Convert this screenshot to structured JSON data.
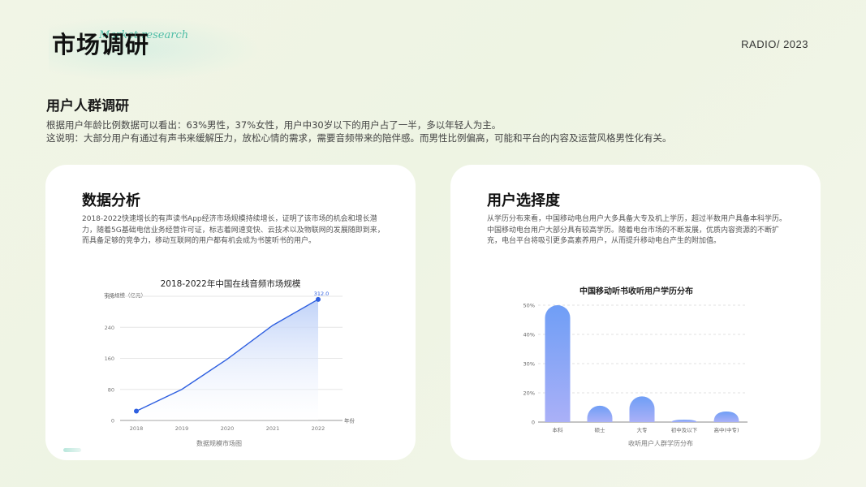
{
  "header": {
    "title": "市场调研",
    "script_text": "Market research",
    "tag": "RADIO/ 2023"
  },
  "section": {
    "title": "用户人群调研",
    "lines": [
      "根据用户年龄比例数据可以看出：63%男性，37%女性，用户中30岁以下的用户占了一半，多以年轻人为主。",
      "这说明：大部分用户有通过有声书来缓解压力，放松心情的需求，需要音频带来的陪伴感。而男性比例偏高，可能和平台的内容及运营风格男性化有关。"
    ]
  },
  "left_card": {
    "title": "数据分析",
    "desc": "2018-2022快速增长的有声读书App经济市场规模持续增长，证明了该市场的机会和增长潜力，随着5G基础电信业务经营许可证，标志着网速变快、云技术以及物联网的发展随即到来，而具备足够的竞争力，移动互联网的用户都有机会成为书箧听书的用户。"
  },
  "right_card": {
    "title": "用户选择度",
    "desc": "从学历分布来看，中国移动电台用户大多具备大专及机上学历，超过半数用户具备本科学历。中国移动电台用户大部分具有较高学历。随着电台市场的不断发展，优质内容资源的不断扩充，电台平台将吸引更多高素养用户，从而提升移动电台产生的附加值。"
  },
  "colors": {
    "line": "#2e5fe0",
    "area_top": "#b9cdf7",
    "bar_top": "#6f9ef6",
    "bar_bottom": "#aab0f7",
    "accent": "#3fb8a0"
  },
  "chart_data": [
    {
      "type": "area",
      "title": "2018-2022年中国在线音频市场规模",
      "ylabel": "市场规模（亿元）",
      "xlabel": "年份",
      "caption": "数据规模市场图",
      "x": [
        "2018",
        "2019",
        "2020",
        "2021",
        "2022"
      ],
      "values": [
        24,
        80,
        158,
        245,
        312
      ],
      "yticks": [
        0,
        80,
        160,
        240,
        320
      ],
      "ylim": [
        0,
        340
      ],
      "data_labels": {
        "2022": "312.0"
      },
      "grid": true
    },
    {
      "type": "bar",
      "title": "中国移动听书收听用户学历分布",
      "caption": "收听用户人群学历分布",
      "categories": [
        "本科",
        "硕士",
        "大专",
        "初中及以下",
        "高中(中专)"
      ],
      "values": [
        50,
        7,
        11,
        1,
        4.5
      ],
      "yticks": [
        "0",
        "20%",
        "30%",
        "40%",
        "50%"
      ],
      "ylim": [
        0,
        50
      ],
      "grid": true
    }
  ]
}
